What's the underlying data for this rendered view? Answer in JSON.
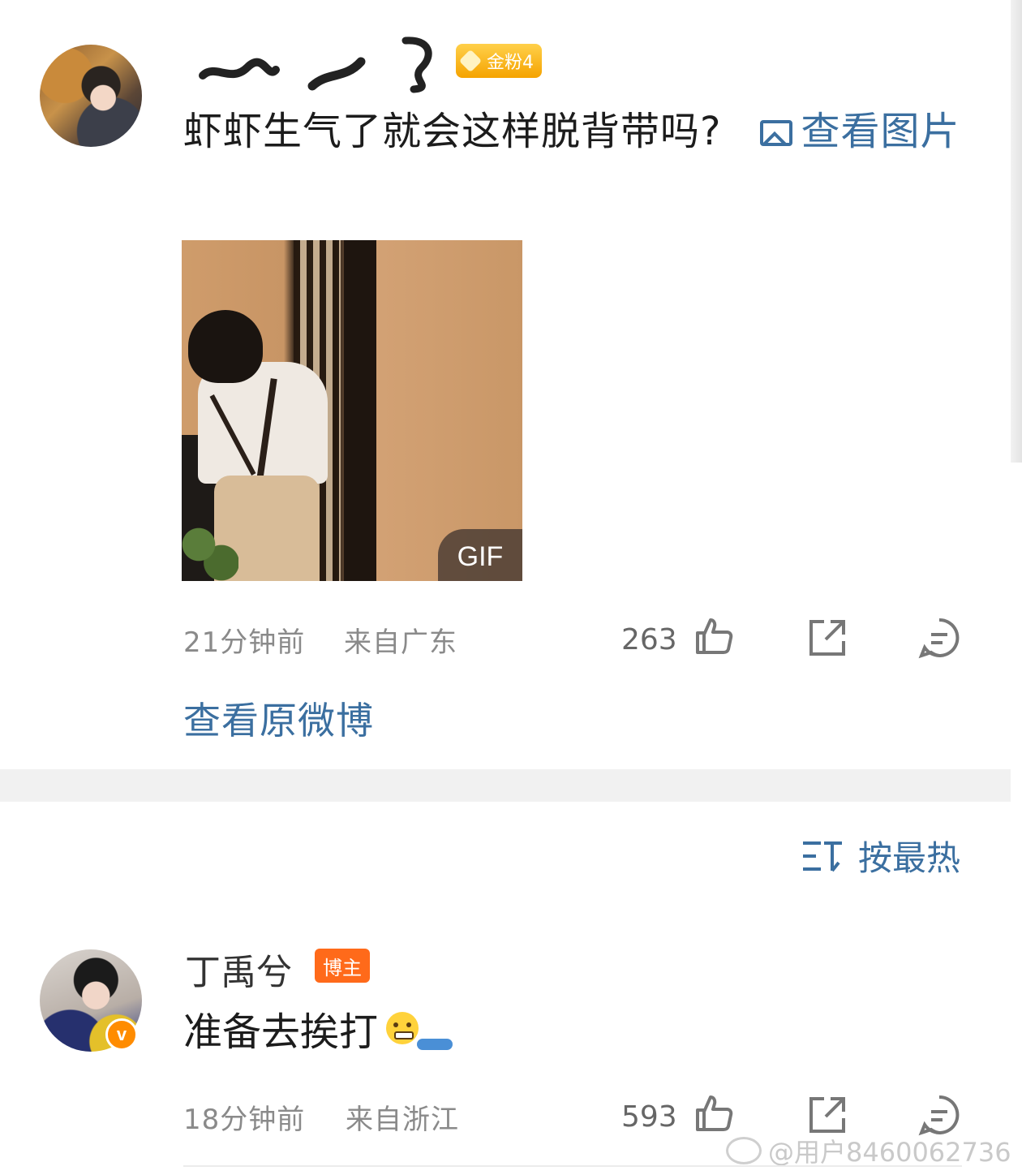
{
  "post": {
    "username_redacted": true,
    "fan_badge": "金粉4",
    "text": "虾虾生气了就会这样脱背带吗?",
    "view_image_link": "查看图片",
    "media_badge": "GIF",
    "time": "21分钟前",
    "location": "来自广东",
    "likes": "263",
    "view_original": "查看原微博"
  },
  "sort": {
    "label": "按最热"
  },
  "reply": {
    "username": "丁禹兮",
    "role_badge": "博主",
    "verified_mark": "v",
    "text": "准备去挨打",
    "time": "18分钟前",
    "location": "来自浙江",
    "likes": "593"
  },
  "watermark": {
    "text": "@用户8460062736"
  },
  "colors": {
    "link": "#3b6fa0",
    "fan_badge": "#f5a300",
    "bozhu_badge": "#ff6a1a",
    "verified": "#ff8c00",
    "meta": "#8a8a8a"
  },
  "icons": [
    "picture-icon",
    "like-icon",
    "share-icon",
    "comment-icon",
    "sort-icon",
    "weibo-logo-icon"
  ]
}
